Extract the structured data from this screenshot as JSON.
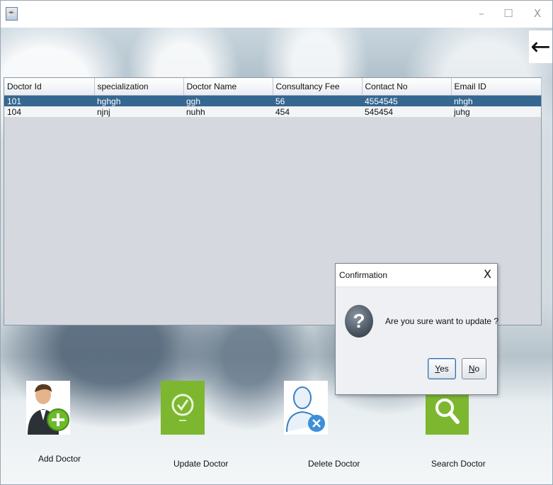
{
  "window": {
    "title": "",
    "controls": {
      "minimize": "–",
      "maximize": "☐",
      "close": "X"
    }
  },
  "header": {
    "back_icon": "arrow-left-icon"
  },
  "table": {
    "columns": [
      "Doctor Id",
      "specialization",
      "Doctor Name",
      "Consultancy Fee",
      "Contact No",
      "Email ID"
    ],
    "rows": [
      {
        "selected": true,
        "cells": [
          "101",
          "hghgh",
          "ggh",
          "56",
          "4554545",
          "nhgh"
        ]
      },
      {
        "selected": false,
        "cells": [
          "104",
          "njnj",
          "nuhh",
          "454",
          "545454",
          "juhg"
        ]
      }
    ]
  },
  "actions": {
    "add": "Add Doctor",
    "update": "Update Doctor",
    "delete": "Delete Doctor",
    "search": "Search Doctor"
  },
  "dialog": {
    "title": "Confirmation",
    "close": "X",
    "message": "Are you sure want to update ?",
    "yes_mnemonic": "Y",
    "yes_rest": "es",
    "no_mnemonic": "N",
    "no_rest": "o"
  },
  "colors": {
    "selection": "#356790",
    "green_tile": "#7db72f",
    "add_badge": "#6cbb2a"
  }
}
